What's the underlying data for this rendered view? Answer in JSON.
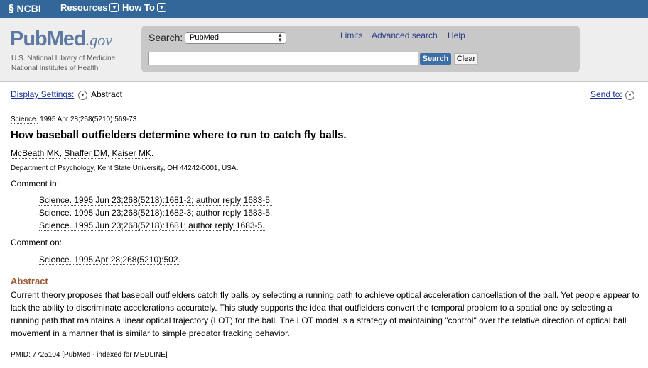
{
  "ncbi_bar": {
    "logo": "NCBI",
    "menus": [
      "Resources",
      "How To"
    ]
  },
  "header": {
    "logo_main": "PubMed",
    "logo_suffix": ".gov",
    "logo_sub1": "U.S. National Library of Medicine",
    "logo_sub2": "National Institutes of Health",
    "search_label": "Search:",
    "database": "PubMed",
    "links": [
      "Limits",
      "Advanced search",
      "Help"
    ],
    "search_value": "",
    "search_button": "Search",
    "clear_button": "Clear"
  },
  "settings": {
    "display_settings": "Display Settings:",
    "format": "Abstract",
    "send_to": "Send to:"
  },
  "article": {
    "journal": "Science.",
    "citation_rest": " 1995 Apr 28;268(5210):569-73.",
    "title": "How baseball outfielders determine where to run to catch fly balls.",
    "authors": [
      "McBeath MK",
      "Shaffer DM",
      "Kaiser MK"
    ],
    "affiliation": "Department of Psychology, Kent State University, OH 44242-0001, USA.",
    "comment_in_label": "Comment in:",
    "comment_in": [
      "Science. 1995 Jun 23;268(5218):1681-2; author reply 1683-5.",
      "Science. 1995 Jun 23;268(5218):1682-3; author reply 1683-5.",
      "Science. 1995 Jun 23;268(5218):1681; author reply 1683-5."
    ],
    "comment_on_label": "Comment on:",
    "comment_on": [
      "Science. 1995 Apr 28;268(5210):502."
    ],
    "abstract_heading": "Abstract",
    "abstract_text": "Current theory proposes that baseball outfielders catch fly balls by selecting a running path to achieve optical acceleration cancellation of the ball. Yet people appear to lack the ability to discriminate accelerations accurately. This study supports the idea that outfielders convert the temporal problem to a spatial one by selecting a running path that maintains a linear optical trajectory (LOT) for the ball. The LOT model is a strategy of maintaining \"control\" over the relative direction of optical ball movement in a manner that is similar to simple predator tracking behavior.",
    "pmid": "PMID: 7725104 [PubMed - indexed for MEDLINE]"
  }
}
